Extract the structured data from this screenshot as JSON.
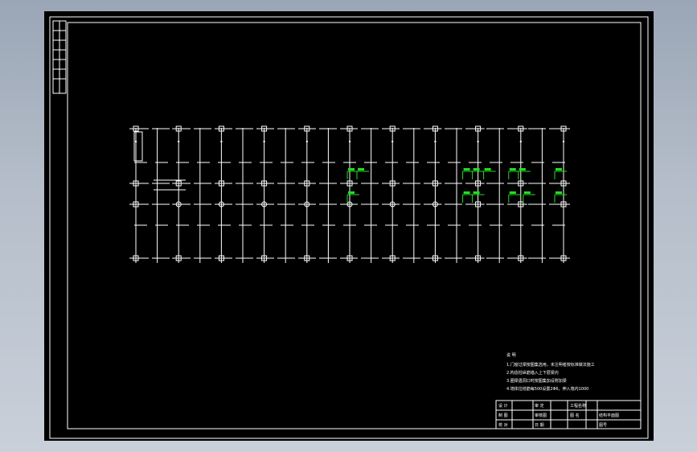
{
  "drawing": {
    "colors": {
      "background": "#000000",
      "linework": "#ffffff",
      "beam_tag": "#22dd22",
      "window_chrome": "#a8b3c2"
    },
    "grid": {
      "columns_count": 11,
      "rows_count": 4,
      "column_symbol": "square-box-icon",
      "round_symbol": "circle-column-icon"
    },
    "notes": {
      "heading": "说 明",
      "lines": [
        "1.门窗过梁按图集选用，未注明者按标准做法施工",
        "2.构造柱纵筋锚入上下层梁内",
        "3.圈梁遇洞口时按图集加设附加梁",
        "4.墙体拉结筋每500设置2Φ6，伸入墙内1000"
      ]
    },
    "title_block": {
      "left_rows": [
        [
          "设 计",
          "",
          "审 定",
          ""
        ],
        [
          "制 图",
          "",
          "审核图",
          ""
        ],
        [
          "校 对",
          "",
          "日 期",
          ""
        ]
      ],
      "right_top": "工程名称",
      "right_mid_left": "图 名",
      "right_mid": "结构平面图",
      "right_bottom": "图号"
    }
  }
}
